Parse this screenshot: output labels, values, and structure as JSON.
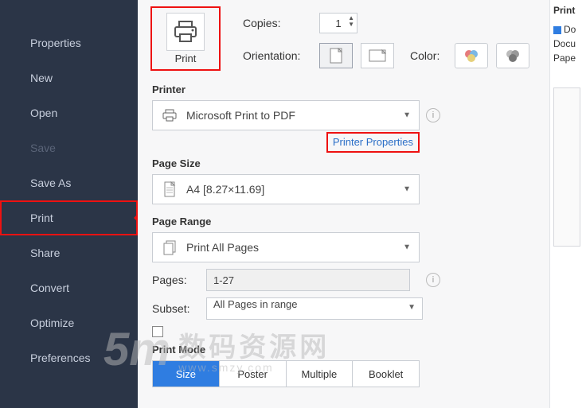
{
  "sidebar": {
    "items": [
      {
        "label": "Properties"
      },
      {
        "label": "New"
      },
      {
        "label": "Open"
      },
      {
        "label": "Save"
      },
      {
        "label": "Save As"
      },
      {
        "label": "Print"
      },
      {
        "label": "Share"
      },
      {
        "label": "Convert"
      },
      {
        "label": "Optimize"
      },
      {
        "label": "Preferences"
      }
    ]
  },
  "print_button": {
    "label": "Print"
  },
  "top": {
    "copies_label": "Copies:",
    "copies_value": "1",
    "orientation_label": "Orientation:",
    "color_label": "Color:"
  },
  "printer": {
    "section": "Printer",
    "value": "Microsoft Print to PDF",
    "props_link": "Printer Properties"
  },
  "pagesize": {
    "section": "Page Size",
    "value": "A4 [8.27×11.69]"
  },
  "pagerange": {
    "section": "Page Range",
    "value": "Print All Pages",
    "pages_label": "Pages:",
    "pages_value": "1-27",
    "subset_label": "Subset:",
    "subset_value": "All Pages in range"
  },
  "printmode": {
    "section": "Print Mode",
    "tabs": [
      "Size",
      "Poster",
      "Multiple",
      "Booklet"
    ]
  },
  "right": {
    "heading": "Print",
    "d_line": "Do",
    "docu": "Docu",
    "pape": "Pape"
  },
  "watermark": {
    "main": "数码资源网",
    "sub": "www.smzy.com",
    "logo": "5m"
  }
}
